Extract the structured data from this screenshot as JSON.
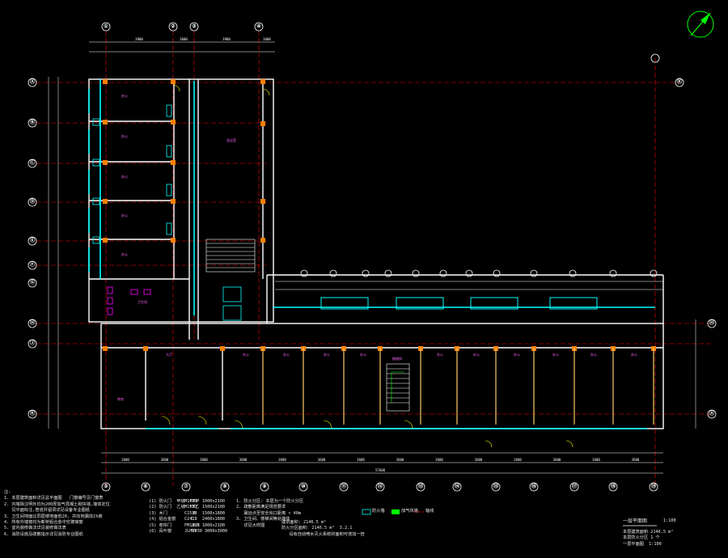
{
  "colors": {
    "background": "#000000",
    "grid_axis": "#ff0000",
    "wall": "#ffffff",
    "column": "#ff7f00",
    "window": "#00ffff",
    "door": "#ffff00",
    "dimension": "#ffffff",
    "stair": "#00ff00",
    "room_text": "#ff00ff",
    "hatch": "#00ffff"
  },
  "north_arrow": {
    "icon": "north-arrow-icon"
  },
  "axis_labels_top": [
    "①",
    "②",
    "③",
    "④"
  ],
  "axis_labels_left": [
    "Ⓐ",
    "Ⓑ",
    "Ⓒ",
    "Ⓓ",
    "Ⓔ",
    "Ⓕ",
    "Ⓖ",
    "Ⓗ",
    "Ⓙ",
    "Ⓚ"
  ],
  "axis_labels_right": [
    "Ⓚ",
    "Ⓗ",
    "Ⓐ"
  ],
  "axis_labels_bottom": [
    "⑤",
    "⑥",
    "⑦",
    "⑧",
    "⑨",
    "⑩",
    "⑪",
    "⑫",
    "⑬",
    "⑭",
    "⑮",
    "⑯",
    "⑰",
    "⑱",
    "⑲"
  ],
  "room_labels": [
    "办公",
    "办公",
    "办公",
    "办公",
    "办公",
    "会议室",
    "库房",
    "大厅",
    "办公",
    "办公",
    "办公",
    "办公",
    "办公",
    "办公",
    "办公",
    "办公",
    "办公",
    "办公",
    "卫生间",
    "楼梯间"
  ],
  "notes": {
    "left": "注:\n1. 本层建筑面积详见总平面图   门窗编号见门窗表\n2. 内墙除注明外均为200厚加气混凝土砌块墙,墙体定位\n   见平面标注,管道井留洞详见设备专业图纸\n3. 卫生间地面比同层楼地面低20, 并向地漏找1%坡\n4. 所有外墙窗均为断桥铝合金中空玻璃窗\n5. 室内装修做法详见装修做法表\n6. 消防设施及疏散指示详见消防专业图纸",
    "mid_a": "(1) 防火门  甲级  FM甲\n(2) 防火门  乙级  FM乙\n(3) 木门          M\n(4) 铝合金窗      C\n(5) 卷帘门        JLM\n(6) 百叶窗        BY",
    "mid_b": "M1021  1000x2100\nM1521  1500x2100\nC1518  1500x1800\nC2418  2400x1800\nFM1021 1000x2100\nJLM3030 3000x3000",
    "mid_c": "1. 防火分区: 本层为一个防火分区\n2. 疏散距离满足规范要求\n   最远点至安全出口距离 < 40m\n3. 卫生间、楼梯间等处墙体\n   详见大样图",
    "right_c": "建筑面积: 2146.5 m²\n防火分区面积: 2146.5 m²  3.2.1\n   设有自动喷水灭火系统的面积可增加一倍",
    "legend_1": "防火墙",
    "legend_2": "加气块墙",
    "legend_3": "轴线",
    "bottom_right_1": "一层平面图",
    "bottom_right_2": "1:100",
    "bottom_right_3": "本层建筑面积 2146.5 m²\n本层防火分区 1 个\n一层平面图  1:100"
  },
  "dimensions": {
    "top_span": [
      "3900",
      "3600",
      "3900",
      "3600"
    ],
    "bottom_span": [
      "3600",
      "3600",
      "3600",
      "3600",
      "3600",
      "3600",
      "3600",
      "3600",
      "3600",
      "3600",
      "3600",
      "3600",
      "3600",
      "3600"
    ],
    "total_bottom": "57600"
  }
}
